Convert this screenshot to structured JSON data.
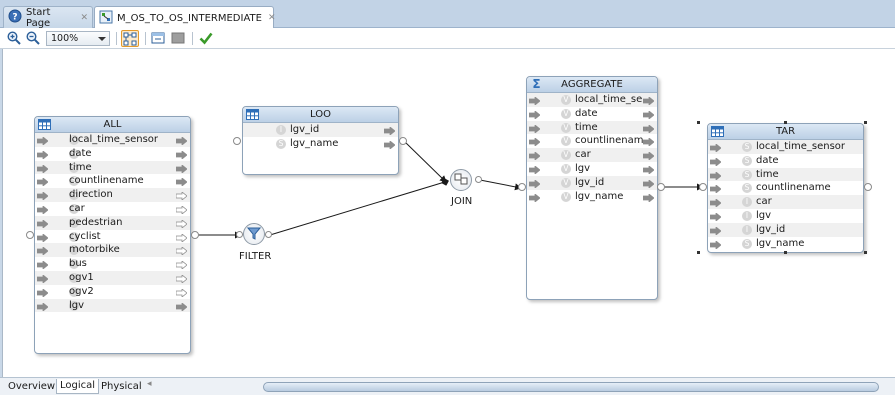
{
  "tabs": [
    {
      "label": "Start Page",
      "icon": "help-icon"
    },
    {
      "label": "M_OS_TO_OS_INTERMEDIATE",
      "icon": "mapping-icon",
      "active": true
    }
  ],
  "toolbar": {
    "zoom": "100%"
  },
  "nodes": {
    "all": {
      "title": "ALL",
      "attributes": [
        {
          "type": "S",
          "name": "local_time_sensor"
        },
        {
          "type": "S",
          "name": "date"
        },
        {
          "type": "S",
          "name": "time"
        },
        {
          "type": "S",
          "name": "countlinename"
        },
        {
          "type": "S",
          "name": "direction"
        },
        {
          "type": "I",
          "name": "car"
        },
        {
          "type": "I",
          "name": "pedestrian"
        },
        {
          "type": "I",
          "name": "cyclist"
        },
        {
          "type": "I",
          "name": "motorbike"
        },
        {
          "type": "I",
          "name": "bus"
        },
        {
          "type": "I",
          "name": "ogv1"
        },
        {
          "type": "I",
          "name": "ogv2"
        },
        {
          "type": "I",
          "name": "lgv"
        }
      ]
    },
    "loo": {
      "title": "LOO",
      "attributes": [
        {
          "type": "I",
          "name": "lgv_id"
        },
        {
          "type": "S",
          "name": "lgv_name"
        }
      ]
    },
    "aggregate": {
      "title": "AGGREGATE",
      "attributes": [
        {
          "type": "V",
          "name": "local_time_se"
        },
        {
          "type": "V",
          "name": "date"
        },
        {
          "type": "V",
          "name": "time"
        },
        {
          "type": "V",
          "name": "countlinenam"
        },
        {
          "type": "V",
          "name": "car"
        },
        {
          "type": "V",
          "name": "lgv"
        },
        {
          "type": "V",
          "name": "lgv_id"
        },
        {
          "type": "V",
          "name": "lgv_name"
        }
      ]
    },
    "tar": {
      "title": "TAR",
      "attributes": [
        {
          "type": "S",
          "name": "local_time_sensor"
        },
        {
          "type": "S",
          "name": "date"
        },
        {
          "type": "S",
          "name": "time"
        },
        {
          "type": "S",
          "name": "countlinename"
        },
        {
          "type": "I",
          "name": "car"
        },
        {
          "type": "I",
          "name": "lgv"
        },
        {
          "type": "I",
          "name": "lgv_id"
        },
        {
          "type": "S",
          "name": "lgv_name"
        }
      ]
    }
  },
  "operators": {
    "filter": "FILTER",
    "join": "JOIN"
  },
  "bottom_tabs": [
    "Overview",
    "Logical",
    "Physical"
  ],
  "colors": {
    "header": "#c4d6ea",
    "accent_green": "#3a9a2a",
    "arrow_gray": "#8c8c8c"
  }
}
